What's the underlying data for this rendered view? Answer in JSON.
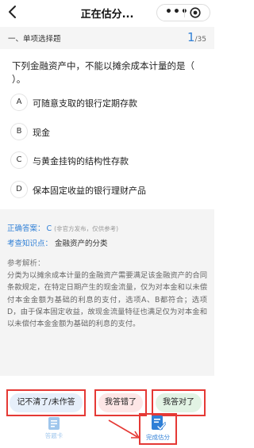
{
  "nav": {
    "title": "正在估分..."
  },
  "section": {
    "title": "一、单项选择题",
    "current": "1",
    "total": "/35"
  },
  "question": {
    "text": "下列金融资产中，不能以摊余成本计量的是（   ）。"
  },
  "options": [
    {
      "letter": "A",
      "text": "可随意支取的银行定期存款"
    },
    {
      "letter": "B",
      "text": "现金"
    },
    {
      "letter": "C",
      "text": "与黄金挂钩的结构性存款"
    },
    {
      "letter": "D",
      "text": "保本固定收益的银行理财产品"
    }
  ],
  "answer": {
    "label": "正确答案：",
    "value": "C",
    "note": "(非官方发布，仅供参考)",
    "kp_label": "考查知识点：",
    "kp_value": "金融资产的分类",
    "exp_label": "参考解析：",
    "exp_text": "分类为以摊余成本计量的金融资产需要满足该金融资产的合同条款规定，在特定日期产生的现金流量，仅为对本金和以未偿付本金金额为基础的利息的支付，选项A、B都符合；选项D，由于保本固定收益，故现金流量特征也满足仅为对本金和以未偿付本金金额为基础的利息的支付。"
  },
  "buttons": {
    "unsure": "记不清了/未作答",
    "wrong": "我答错了",
    "right": "我答对了"
  },
  "tabs": {
    "card": "答题卡",
    "finish": "完成估分"
  },
  "colors": {
    "accent": "#2f7fd6",
    "annotation": "#e53935"
  }
}
